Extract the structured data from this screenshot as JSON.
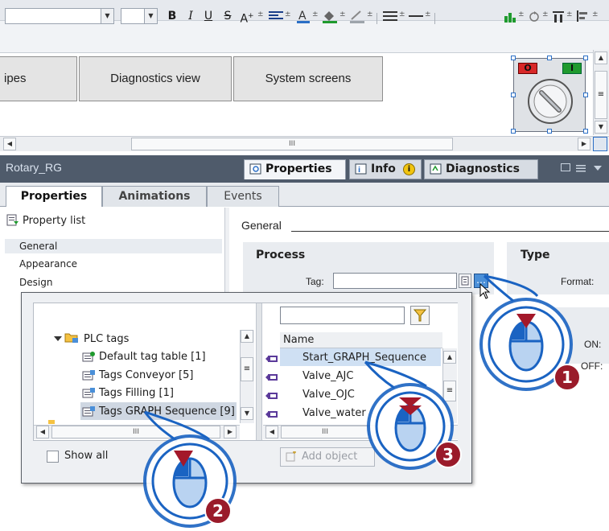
{
  "toolbar": {
    "bold": "B",
    "italic": "I",
    "underline": "U",
    "strikethrough": "S",
    "font_size_icon": "A",
    "colors": {
      "accent": "#2b6fc6",
      "green": "#1f9a2e",
      "red": "#d22"
    }
  },
  "screen_nav": {
    "buttons": [
      {
        "label": "ipes"
      },
      {
        "label": "Diagnostics view"
      },
      {
        "label": "System screens"
      }
    ],
    "scroll_mid": "III"
  },
  "rotary": {
    "off_label": "O",
    "on_label": "I"
  },
  "inspector": {
    "object_name": "Rotary_RG",
    "tabs": [
      {
        "label": "Properties"
      },
      {
        "label": "Info"
      },
      {
        "label": "Diagnostics"
      }
    ],
    "subtabs": [
      {
        "label": "Properties"
      },
      {
        "label": "Animations"
      },
      {
        "label": "Events"
      }
    ],
    "property_list_label": "Property list",
    "left_items": [
      "General",
      "Appearance",
      "Design"
    ],
    "general_heading": "General",
    "process": {
      "title": "Process",
      "tag_label": "Tag:",
      "tag_value": ""
    },
    "type": {
      "title": "Type",
      "format_label": "Format:"
    },
    "display": {
      "on_label": "ON:",
      "off_label": "OFF:"
    }
  },
  "popup": {
    "filter_value": "",
    "tree": [
      {
        "label": "PLC tags"
      },
      {
        "label": "Default tag table [1]"
      },
      {
        "label": "Tags Conveyor [5]"
      },
      {
        "label": "Tags Filling [1]"
      },
      {
        "label": "Tags GRAPH Sequence [9]"
      }
    ],
    "list_header": "Name",
    "list_rows": [
      {
        "name": "Start_GRAPH_Sequence"
      },
      {
        "name": "Valve_AJC"
      },
      {
        "name": "Valve_OJC"
      },
      {
        "name": "Valve_water"
      }
    ],
    "tree_scroll_mid": "III",
    "list_scroll_mid": "III",
    "show_all_label": "Show all",
    "add_object_label": "Add object"
  },
  "callouts": [
    {
      "number": "1"
    },
    {
      "number": "2"
    },
    {
      "number": "3"
    }
  ]
}
